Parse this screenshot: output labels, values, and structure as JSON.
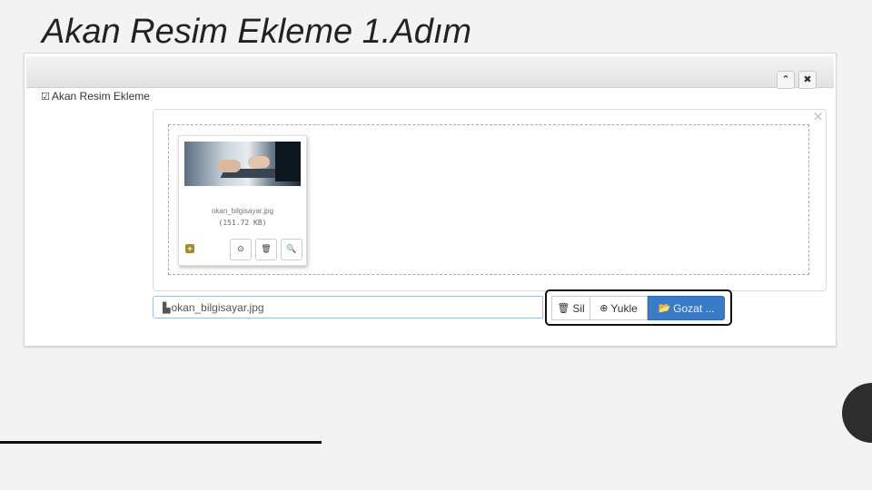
{
  "slide": {
    "title": "Akan Resim Ekleme 1.Adım"
  },
  "panel": {
    "title": "Akan Resim Ekleme",
    "header_buttons": {
      "collapse": "⌃",
      "close": "✖"
    }
  },
  "upload": {
    "close": "×",
    "thumbnail": {
      "filename": "okan_bilgisayar.jpg",
      "size": "(151.72 KB)",
      "actions": {
        "upload": "⊙",
        "delete": "🗑",
        "zoom": "🔍"
      }
    },
    "file_field_value": "okan_bilgisayar.jpg",
    "buttons": {
      "delete": "Sil",
      "upload": "Yukle",
      "browse": "Gozat ..."
    }
  },
  "colors": {
    "primary": "#3a7bc8",
    "highlight_border": "#111111"
  }
}
